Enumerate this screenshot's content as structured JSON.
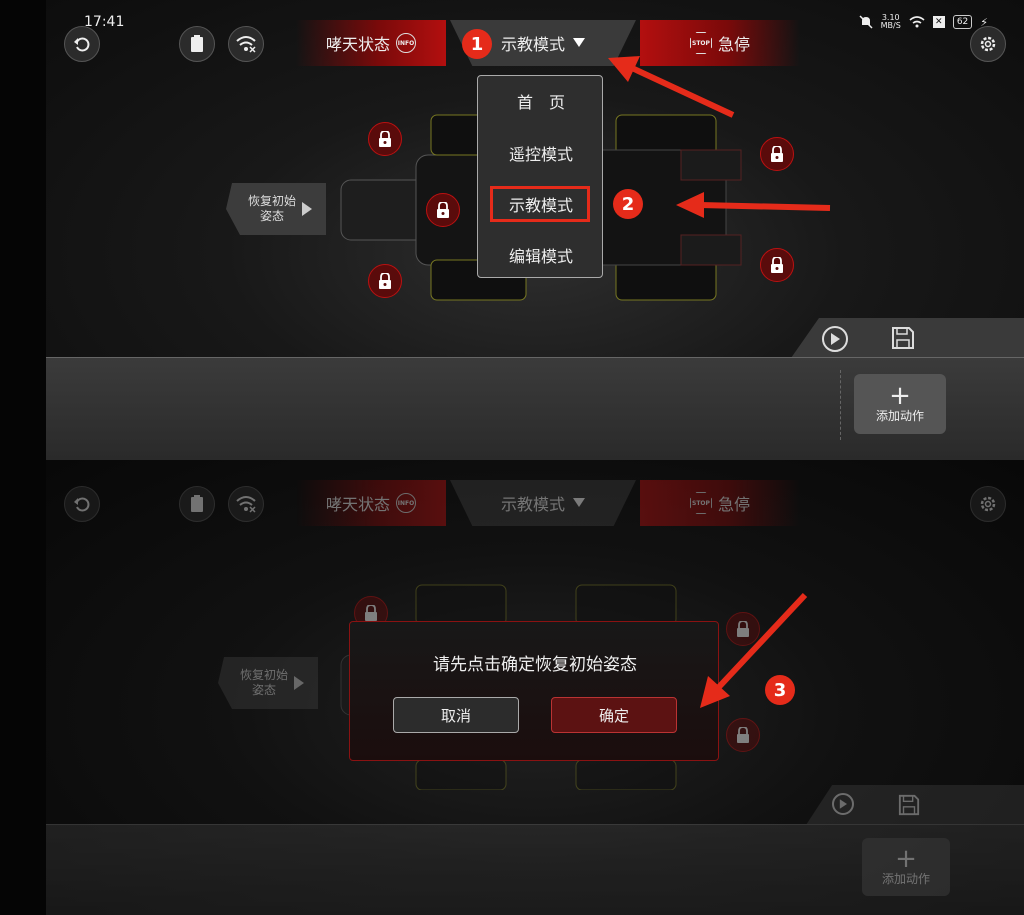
{
  "status_bar": {
    "time": "17:41",
    "net_speed_value": "3.10",
    "net_speed_unit": "MB/S",
    "battery": "62"
  },
  "top_bar": {
    "status_tab_label": "哮天状态",
    "info_badge": "INFO",
    "mode_label": "示教模式",
    "estop_label": "急停",
    "stop_badge": "STOP"
  },
  "dropdown": {
    "items": [
      "首　页",
      "遥控模式",
      "示教模式",
      "编辑模式"
    ],
    "selected": "示教模式"
  },
  "restore_pose_label": "恢复初始姿态",
  "restore_pose_lines": [
    "恢复初始",
    "姿态"
  ],
  "add_action_label": "添加动作",
  "dialog": {
    "message": "请先点击确定恢复初始姿态",
    "cancel_label": "取消",
    "confirm_label": "确定"
  },
  "annotations": {
    "step1": "1",
    "step2": "2",
    "step3": "3"
  },
  "colors": {
    "accent_red": "#e52b1a",
    "lock_red": "#5a0b0b",
    "dark_bg": "#111111"
  },
  "icons": [
    "back-icon",
    "clipboard-icon",
    "wifi-off-icon",
    "settings-icon",
    "lock-icon",
    "play-icon",
    "save-icon",
    "plus-icon",
    "dropdown-triangle-icon",
    "info-icon",
    "stop-icon"
  ]
}
